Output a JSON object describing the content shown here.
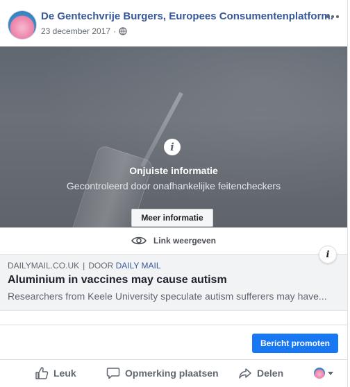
{
  "post": {
    "page_name": "De Gentechvrije Burgers, Europees Consumentenplatform.",
    "date": "23 december 2017",
    "separator": "·"
  },
  "overlay": {
    "title": "Onjuiste informatie",
    "subtitle": "Gecontroleerd door onafhankelijke feitencheckers",
    "button_label": "Meer informatie"
  },
  "view_link": {
    "label": "Link weergeven"
  },
  "link_preview": {
    "domain": "DAILYMAIL.CO.UK",
    "divider": "|",
    "by_prefix": "DOOR",
    "by_name": "DAILY MAIL",
    "headline": "Aluminium in vaccines may cause autism",
    "snippet": "Researchers from Keele University speculate autism sufferers may have..."
  },
  "promote": {
    "button_label": "Bericht promoten"
  },
  "actions": {
    "like": "Leuk",
    "comment": "Opmerking plaatsen",
    "share": "Delen"
  },
  "colors": {
    "brand_blue": "#385898",
    "primary_button": "#1877f2",
    "text_secondary": "#606770"
  },
  "icons": [
    "globe-icon",
    "more-icon",
    "info-icon",
    "eye-icon",
    "like-icon",
    "comment-icon",
    "share-icon",
    "chevron-down-icon"
  ]
}
